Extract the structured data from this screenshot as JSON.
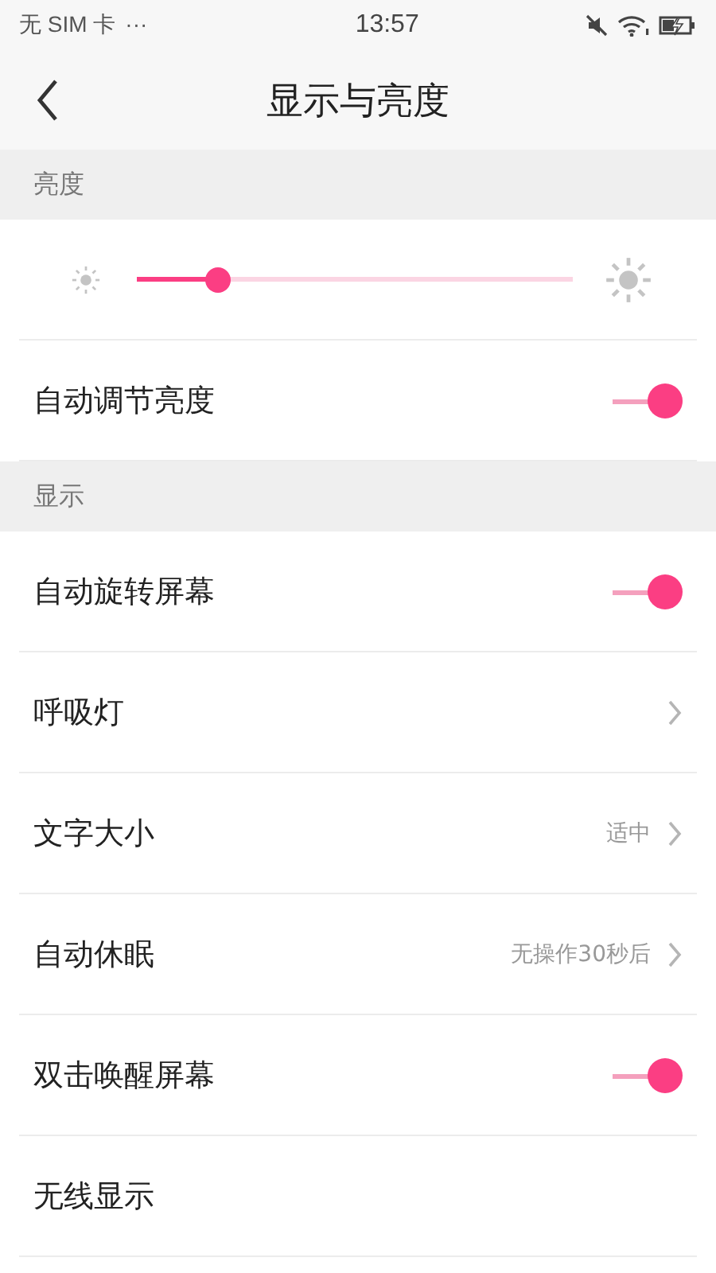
{
  "status_bar": {
    "carrier": "无 SIM 卡",
    "more": "···",
    "time": "13:57"
  },
  "header": {
    "title": "显示与亮度"
  },
  "sections": [
    {
      "title": "亮度",
      "items": [
        {
          "kind": "slider",
          "level": 0.185
        },
        {
          "kind": "toggle",
          "label": "自动调节亮度",
          "on": true
        }
      ]
    },
    {
      "title": "显示",
      "items": [
        {
          "kind": "toggle",
          "label": "自动旋转屏幕",
          "on": true
        },
        {
          "kind": "link",
          "label": "呼吸灯"
        },
        {
          "kind": "link",
          "label": "文字大小",
          "value": "适中"
        },
        {
          "kind": "link",
          "label": "自动休眠",
          "value": "无操作30秒后"
        },
        {
          "kind": "toggle",
          "label": "双击唤醒屏幕",
          "on": true
        },
        {
          "kind": "plain",
          "label": "无线显示"
        }
      ]
    }
  ]
}
